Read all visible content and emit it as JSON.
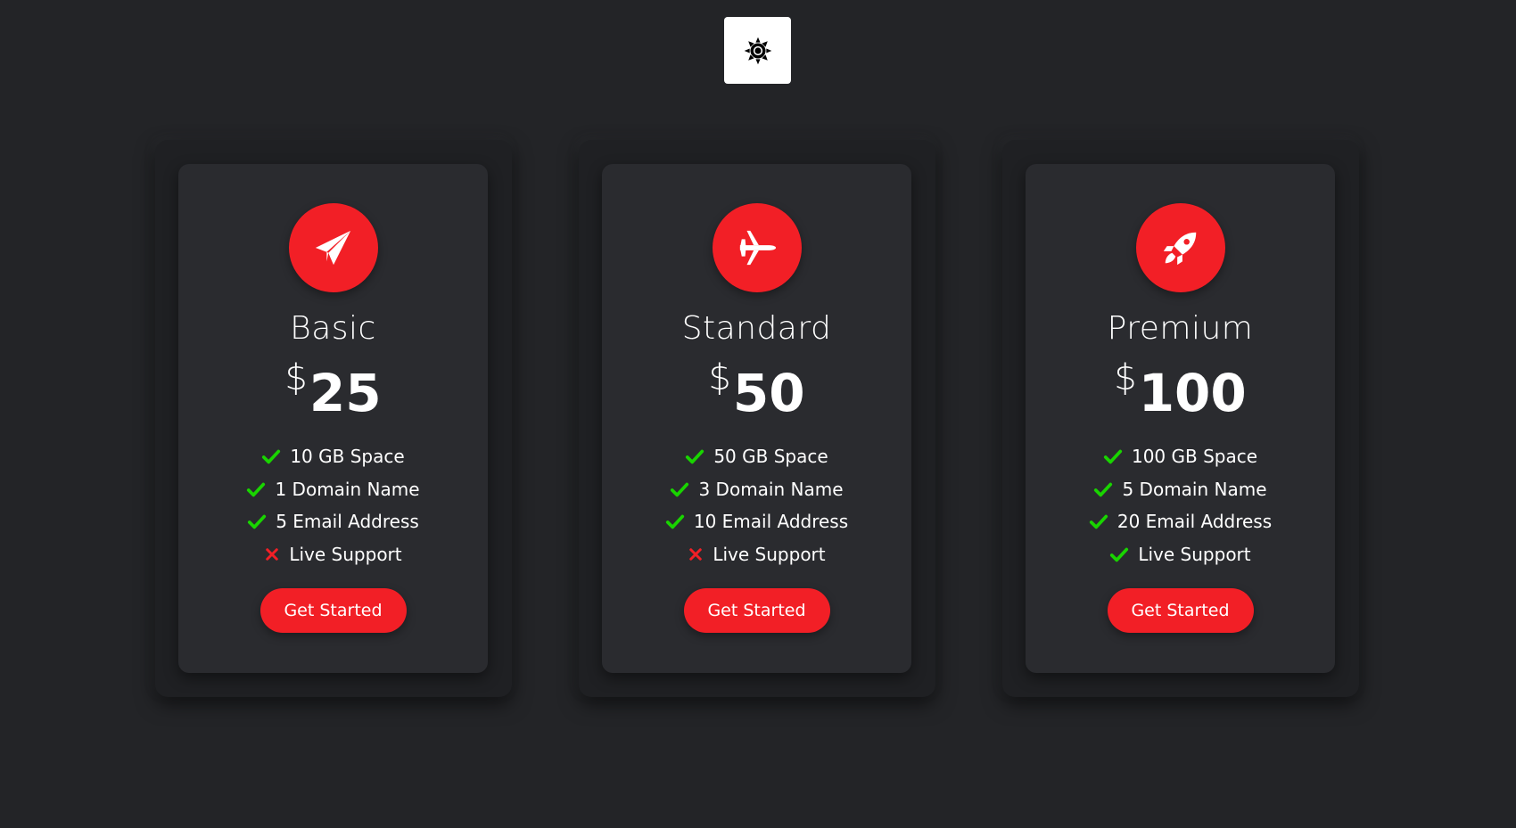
{
  "theme_toggle": {
    "icon": "sun-icon"
  },
  "colors": {
    "background": "#232427",
    "card_outer": "#1f2023",
    "card_inner": "#2a2b2f",
    "accent": "#f21f26",
    "check": "#19d400",
    "cross": "#f21f26",
    "text": "#ffffff"
  },
  "plans": [
    {
      "name": "Basic",
      "icon": "paper-plane-icon",
      "currency": "$",
      "price": "25",
      "features": [
        {
          "label": "10 GB Space",
          "included": true
        },
        {
          "label": "1 Domain Name",
          "included": true
        },
        {
          "label": "5 Email Address",
          "included": true
        },
        {
          "label": "Live Support",
          "included": false
        }
      ],
      "cta": "Get Started"
    },
    {
      "name": "Standard",
      "icon": "airplane-icon",
      "currency": "$",
      "price": "50",
      "features": [
        {
          "label": "50 GB Space",
          "included": true
        },
        {
          "label": "3 Domain Name",
          "included": true
        },
        {
          "label": "10 Email Address",
          "included": true
        },
        {
          "label": "Live Support",
          "included": false
        }
      ],
      "cta": "Get Started"
    },
    {
      "name": "Premium",
      "icon": "rocket-icon",
      "currency": "$",
      "price": "100",
      "features": [
        {
          "label": "100 GB Space",
          "included": true
        },
        {
          "label": "5 Domain Name",
          "included": true
        },
        {
          "label": "20 Email Address",
          "included": true
        },
        {
          "label": "Live Support",
          "included": true
        }
      ],
      "cta": "Get Started"
    }
  ]
}
